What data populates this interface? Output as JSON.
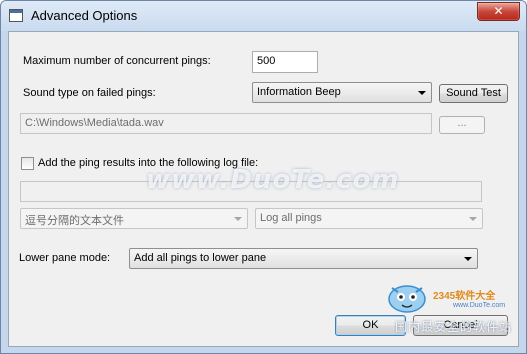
{
  "window": {
    "title": "Advanced Options",
    "close_glyph": "✕"
  },
  "fields": {
    "max_pings_label": "Maximum number of concurrent pings:",
    "max_pings_value": "500",
    "sound_type_label": "Sound type on failed pings:",
    "sound_type_value": "Information Beep",
    "sound_test_label": "Sound Test",
    "sound_path_value": "C:\\Windows\\Media\\tada.wav",
    "browse_label": "...",
    "log_checkbox_label": "Add the ping results into the following log file:",
    "log_checked": false,
    "log_path_value": "",
    "log_format_value": "逗号分隔的文本文件",
    "log_level_value": "Log all pings",
    "lower_pane_label": "Lower pane mode:",
    "lower_pane_value": "Add all pings to lower pane"
  },
  "buttons": {
    "ok_label": "OK",
    "cancel_label": "Cancel"
  },
  "watermarks": {
    "center_text": "www.DuoTe.com",
    "logo_text": "2345软件大全",
    "logo_url": "www.DuoTe.com",
    "logo_sub": "国内最安全的软件站"
  },
  "colors": {
    "titlebar_bg": "#c9dbef",
    "close_button": "#c7463a",
    "default_button_border": "#3c7fb1"
  }
}
